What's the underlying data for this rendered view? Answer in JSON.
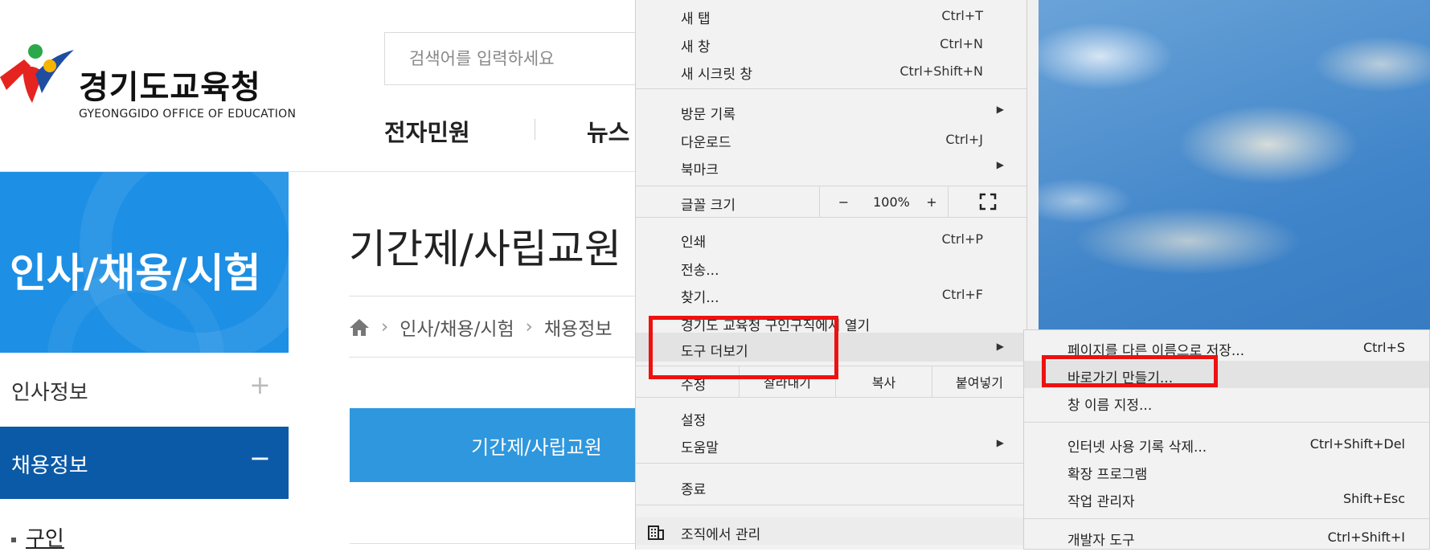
{
  "site": {
    "logo_korean": "경기도교육청",
    "logo_english": "GYEONGGIDO OFFICE OF EDUCATION",
    "search_placeholder": "검색어를 입력하세요",
    "gnb": [
      "전자민원",
      "뉴스"
    ]
  },
  "sidebar": {
    "title": "인사/채용/시험",
    "items": [
      {
        "label": "인사정보",
        "symbol": "+"
      },
      {
        "label": "채용정보",
        "symbol": "−"
      }
    ],
    "sub_item": "구인"
  },
  "content": {
    "page_title": "기간제/사립교원",
    "breadcrumb": [
      "인사/채용/시험",
      "채용정보"
    ],
    "active_tab": "기간제/사립교원"
  },
  "menu": {
    "new_tab": {
      "label": "새 탭",
      "shortcut": "Ctrl+T"
    },
    "new_window": {
      "label": "새 창",
      "shortcut": "Ctrl+N"
    },
    "new_incognito": {
      "label": "새 시크릿 창",
      "shortcut": "Ctrl+Shift+N"
    },
    "history": {
      "label": "방문 기록"
    },
    "downloads": {
      "label": "다운로드",
      "shortcut": "Ctrl+J"
    },
    "bookmarks": {
      "label": "북마크"
    },
    "zoom": {
      "label": "글꼴 크기",
      "minus": "−",
      "value": "100%",
      "plus": "+"
    },
    "print": {
      "label": "인쇄",
      "shortcut": "Ctrl+P"
    },
    "cast": {
      "label": "전송..."
    },
    "find": {
      "label": "찾기...",
      "shortcut": "Ctrl+F"
    },
    "open_in": {
      "label": "경기도 교육청 구인구직에서 열기"
    },
    "more_tools": {
      "label": "도구 더보기"
    },
    "edit": {
      "label": "수정",
      "cut": "잘라내기",
      "copy": "복사",
      "paste": "붙여넣기"
    },
    "settings": {
      "label": "설정"
    },
    "help": {
      "label": "도움말"
    },
    "exit": {
      "label": "종료"
    },
    "managed": {
      "label": "조직에서 관리"
    }
  },
  "submenu": {
    "save_page": {
      "label": "페이지를 다른 이름으로 저장...",
      "shortcut": "Ctrl+S"
    },
    "create_shortcut": {
      "label": "바로가기 만들기..."
    },
    "name_window": {
      "label": "창 이름 지정..."
    },
    "clear_data": {
      "label": "인터넷 사용 기록 삭제...",
      "shortcut": "Ctrl+Shift+Del"
    },
    "extensions": {
      "label": "확장 프로그램"
    },
    "task_manager": {
      "label": "작업 관리자",
      "shortcut": "Shift+Esc"
    },
    "dev_tools": {
      "label": "개발자 도구",
      "shortcut": "Ctrl+Shift+I"
    }
  },
  "colors": {
    "sidebar_blue": "#1d8fe4",
    "sidebar_active": "#0b5aa7",
    "tab_blue": "#2f97dd",
    "highlight_red": "#ee1111"
  }
}
